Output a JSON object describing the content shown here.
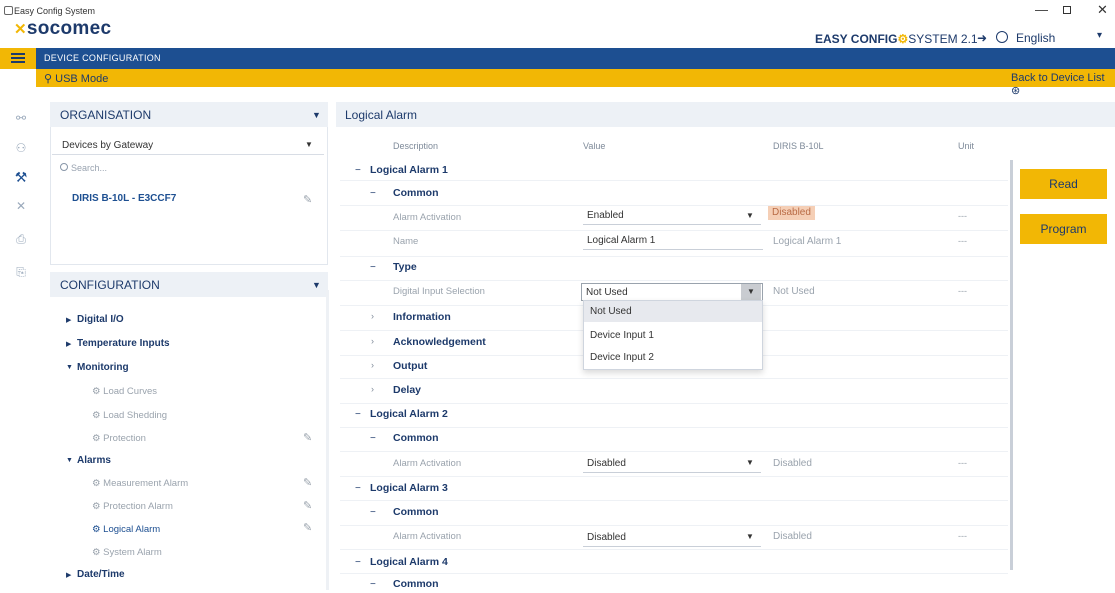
{
  "window": {
    "title": "Easy Config System",
    "controls": [
      "minimize",
      "maximize",
      "close"
    ]
  },
  "header": {
    "logo": "socomec",
    "system_name_bold": "EASY CONFIG",
    "system_name_thin": "SYSTEM 2.1",
    "language": "English",
    "section": "DEVICE CONFIGURATION",
    "mode": "USB Mode",
    "back_link": "Back to Device List"
  },
  "organisation": {
    "title": "ORGANISATION",
    "group_by": "Devices by Gateway",
    "search_placeholder": "Search...",
    "device": "DIRIS B-10L - E3CCF7"
  },
  "configuration": {
    "title": "CONFIGURATION",
    "items": [
      {
        "label": "Digital I/O",
        "level": 1
      },
      {
        "label": "Temperature Inputs",
        "level": 1
      },
      {
        "label": "Monitoring",
        "level": 1
      },
      {
        "label": "Load Curves",
        "level": 2
      },
      {
        "label": "Load Shedding",
        "level": 2
      },
      {
        "label": "Protection",
        "level": 2
      },
      {
        "label": "Alarms",
        "level": 1
      },
      {
        "label": "Measurement Alarm",
        "level": 2
      },
      {
        "label": "Protection Alarm",
        "level": 2
      },
      {
        "label": "Logical Alarm",
        "level": 2
      },
      {
        "label": "System Alarm",
        "level": 2
      },
      {
        "label": "Date/Time",
        "level": 1
      }
    ]
  },
  "main": {
    "title": "Logical Alarm",
    "columns": {
      "description": "Description",
      "value": "Value",
      "device": "DIRIS B-10L",
      "unit": "Unit"
    },
    "rows": {
      "la1": "Logical Alarm 1",
      "common": "Common",
      "alarm_activation": "Alarm Activation",
      "la1_activation_value": "Enabled",
      "la1_activation_device": "Disabled",
      "name": "Name",
      "la1_name_value": "Logical Alarm 1",
      "la1_name_device": "Logical Alarm 1",
      "type": "Type",
      "digital_input_selection": "Digital Input Selection",
      "dis_value": "Not Used",
      "dis_device": "Not Used",
      "information": "Information",
      "acknowledgement": "Acknowledgement",
      "output": "Output",
      "delay": "Delay",
      "la2": "Logical Alarm 2",
      "la2_activation_value": "Disabled",
      "la2_activation_device": "Disabled",
      "la3": "Logical Alarm 3",
      "la3_activation_value": "Disabled",
      "la3_activation_device": "Disabled",
      "la4": "Logical Alarm 4",
      "dash": "---"
    },
    "dropdown_options": [
      "Not Used",
      "Device Input 1",
      "Device Input 2"
    ]
  },
  "actions": {
    "read": "Read",
    "program": "Program"
  }
}
